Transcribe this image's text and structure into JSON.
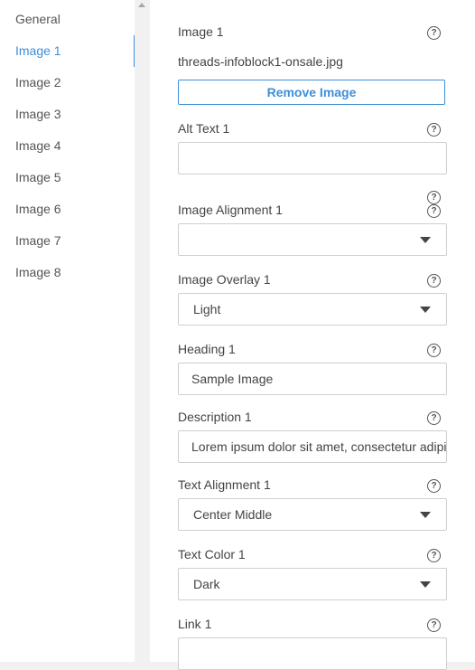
{
  "sidebar": {
    "items": [
      {
        "label": "General"
      },
      {
        "label": "Image 1"
      },
      {
        "label": "Image 2"
      },
      {
        "label": "Image 3"
      },
      {
        "label": "Image 4"
      },
      {
        "label": "Image 5"
      },
      {
        "label": "Image 6"
      },
      {
        "label": "Image 7"
      },
      {
        "label": "Image 8"
      }
    ]
  },
  "accent_color": "#3d8fd8",
  "form": {
    "image": {
      "label": "Image 1",
      "filename": "threads-infoblock1-onsale.jpg",
      "remove_label": "Remove Image"
    },
    "alt_text": {
      "label": "Alt Text 1",
      "value": ""
    },
    "image_alignment": {
      "label": "Image Alignment 1",
      "value": ""
    },
    "image_overlay": {
      "label": "Image Overlay 1",
      "value": "Light"
    },
    "heading": {
      "label": "Heading 1",
      "value": "Sample Image"
    },
    "description": {
      "label": "Description 1",
      "value": "Lorem ipsum dolor sit amet, consectetur adipis"
    },
    "text_alignment": {
      "label": "Text Alignment 1",
      "value": "Center Middle"
    },
    "text_color": {
      "label": "Text Color 1",
      "value": "Dark"
    },
    "link": {
      "label": "Link 1",
      "value": ""
    },
    "help_glyph": "?"
  }
}
